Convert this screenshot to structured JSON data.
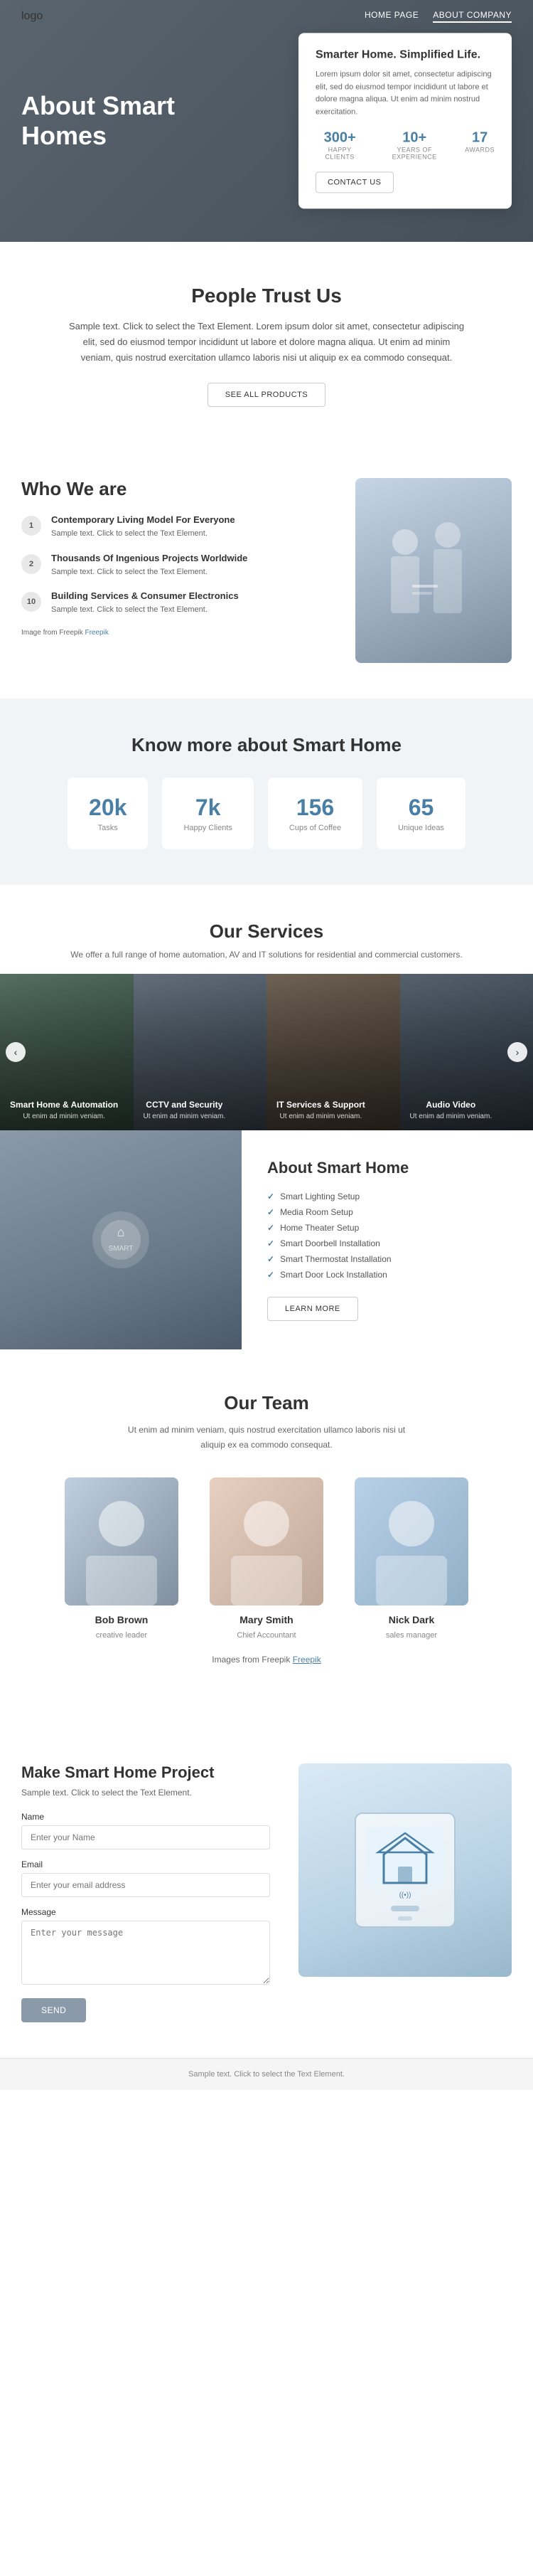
{
  "nav": {
    "logo": "logo",
    "links": [
      {
        "label": "HOME PAGE",
        "href": "#",
        "active": false
      },
      {
        "label": "ABOUT COMPANY",
        "href": "#",
        "active": true
      }
    ]
  },
  "hero": {
    "title": "About Smart Homes",
    "card": {
      "heading": "Smarter Home. Simplified Life.",
      "body": "Lorem ipsum dolor sit amet, consectetur adipiscing elit, sed do eiusmod tempor incididunt ut labore et dolore magna aliqua. Ut enim ad minim nostrud exercitation.",
      "stats": [
        {
          "num": "300+",
          "label": "HAPPY CLIENTS"
        },
        {
          "num": "10+",
          "label": "YEARS OF EXPERIENCE"
        },
        {
          "num": "17",
          "label": "AWARDS"
        }
      ],
      "btn": "CONTACT US"
    }
  },
  "trust": {
    "heading": "People Trust Us",
    "body": "Sample text. Click to select the Text Element. Lorem ipsum dolor sit amet, consectetur adipiscing elit, sed do eiusmod tempor incididunt ut labore et dolore magna aliqua. Ut enim ad minim veniam, quis nostrud exercitation ullamco laboris nisi ut aliquip ex ea commodo consequat.",
    "btn": "SEE ALL PRODUCTS"
  },
  "who": {
    "heading": "Who We are",
    "items": [
      {
        "num": "1",
        "title": "Contemporary Living Model For Everyone",
        "desc": "Sample text. Click to select the Text Element."
      },
      {
        "num": "2",
        "title": "Thousands Of Ingenious Projects Worldwide",
        "desc": "Sample text. Click to select the Text Element."
      },
      {
        "num": "10",
        "title": "Building Services & Consumer Electronics",
        "desc": "Sample text. Click to select the Text Element."
      }
    ],
    "freepik": "Image from Freepik"
  },
  "know": {
    "heading": "Know more about Smart Home",
    "stats": [
      {
        "num": "20k",
        "label": "Tasks"
      },
      {
        "num": "7k",
        "label": "Happy Clients"
      },
      {
        "num": "156",
        "label": "Cups of Coffee"
      },
      {
        "num": "65",
        "label": "Unique Ideas"
      }
    ]
  },
  "services": {
    "heading": "Our Services",
    "desc": "We offer a full range of home automation, AV and IT solutions for residential and commercial customers.",
    "items": [
      {
        "title": "Smart Home & Automation",
        "desc": "Ut enim ad minim veniam."
      },
      {
        "title": "CCTV and Security",
        "desc": "Ut enim ad minim veniam."
      },
      {
        "title": "IT Services & Support",
        "desc": "Ut enim ad minim veniam."
      },
      {
        "title": "Audio Video",
        "desc": "Ut enim ad minim veniam."
      }
    ],
    "prev_btn": "‹",
    "next_btn": "›"
  },
  "about_sh": {
    "heading": "About Smart Home",
    "list": [
      "Smart Lighting Setup",
      "Media Room Setup",
      "Home Theater Setup",
      "Smart Doorbell Installation",
      "Smart Thermostat Installation",
      "Smart Door Lock Installation"
    ],
    "btn": "LEARN MORE"
  },
  "team": {
    "heading": "Our Team",
    "desc": "Ut enim ad minim veniam, quis nostrud exercitation ullamco laboris nisi ut aliquip ex ea commodo consequat.",
    "members": [
      {
        "name": "Bob Brown",
        "role": "creative leader"
      },
      {
        "name": "Mary Smith",
        "role": "Chief Accountant"
      },
      {
        "name": "Nick Dark",
        "role": "sales manager"
      }
    ],
    "freepik": "Images from Freepik"
  },
  "contact": {
    "heading": "Make Smart Home Project",
    "desc": "Sample text. Click to select the Text Element.",
    "fields": {
      "name_label": "Name",
      "name_placeholder": "Enter your Name",
      "email_label": "Email",
      "email_placeholder": "Enter your email address",
      "message_label": "Message",
      "message_placeholder": "Enter your message"
    },
    "btn": "SEND"
  },
  "footer": {
    "text": "Sample text. Click to select the Text Element."
  }
}
